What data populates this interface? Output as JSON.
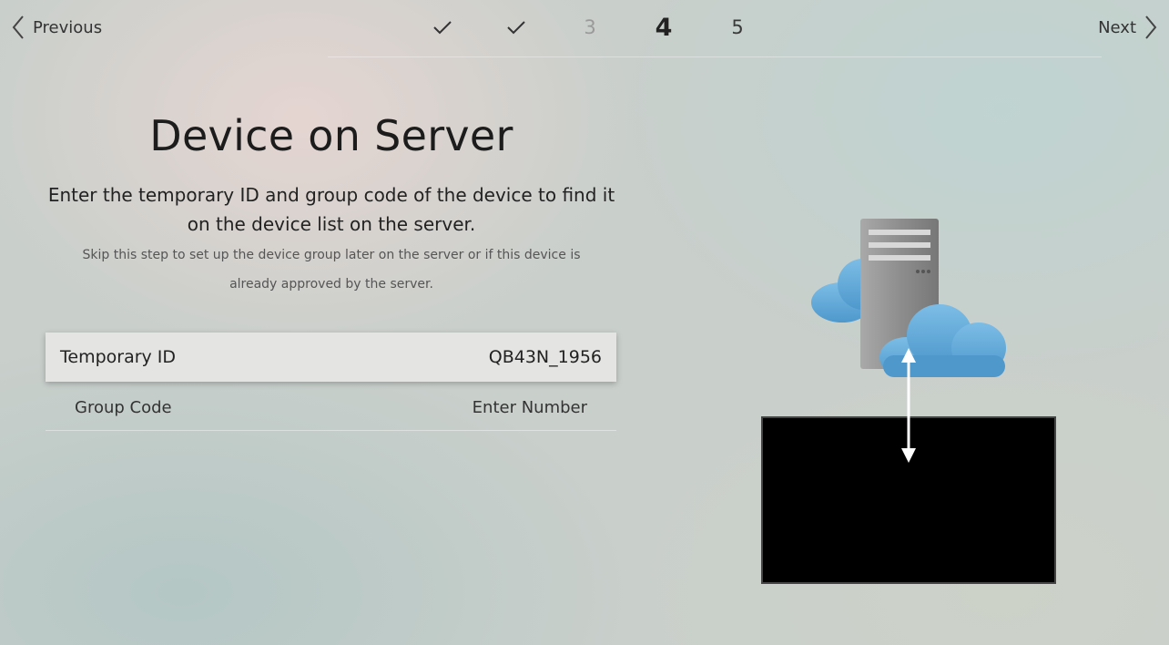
{
  "nav": {
    "previous_label": "Previous",
    "next_label": "Next"
  },
  "steps": [
    {
      "label": "✓",
      "state": "done"
    },
    {
      "label": "✓",
      "state": "done"
    },
    {
      "label": "3",
      "state": "skipped"
    },
    {
      "label": "4",
      "state": "current"
    },
    {
      "label": "5",
      "state": "upcoming"
    }
  ],
  "page": {
    "title": "Device on Server",
    "description_line1": "Enter the temporary ID and group code of the device to find it",
    "description_line2": "on the device list on the server.",
    "hint_line1": "Skip this step to set up the device group later on the server or if this device is",
    "hint_line2": "already approved by the server."
  },
  "fields": {
    "temporary_id": {
      "label": "Temporary ID",
      "value": "QB43N_1956"
    },
    "group_code": {
      "label": "Group Code",
      "placeholder": "Enter Number"
    }
  },
  "illustration": {
    "icons": [
      "server-icon",
      "cloud-icon",
      "cloud-icon",
      "arrow-updown-icon",
      "display-icon"
    ],
    "colors": {
      "cloud": "#5aa6d8",
      "server": "#9a9a9a",
      "display": "#000000"
    }
  }
}
